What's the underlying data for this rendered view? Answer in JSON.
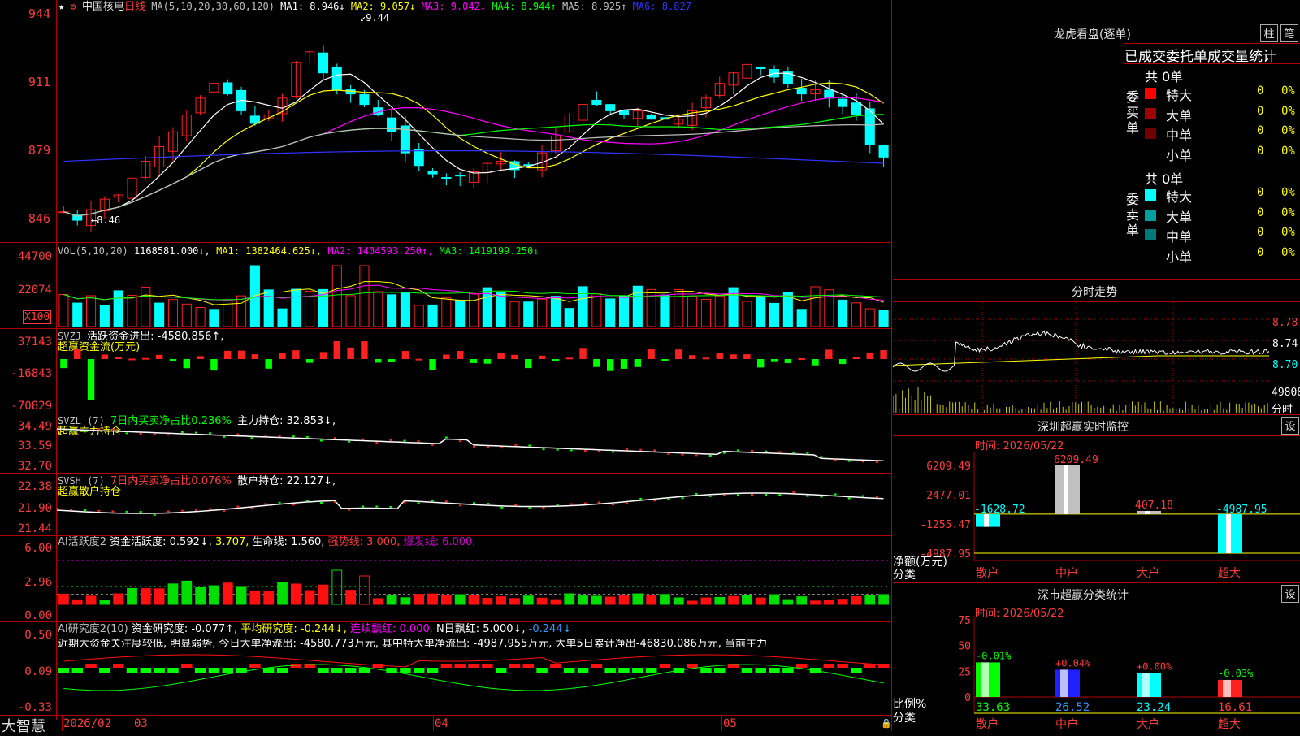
{
  "title": {
    "stock_name": "中国核电",
    "period": "日线",
    "ma_label": "MA(5,10,20,30,60,120)",
    "ma_values": [
      {
        "label": "MA1:",
        "value": "8.946↓",
        "color": "#ffffff"
      },
      {
        "label": "MA2:",
        "value": "9.057↓",
        "color": "#ffff00"
      },
      {
        "label": "MA3:",
        "value": "9.042↓",
        "color": "#ff00ff"
      },
      {
        "label": "MA4:",
        "value": "8.944↑",
        "color": "#00ff00"
      },
      {
        "label": "MA5:",
        "value": "8.925↑",
        "color": "#c0c0c0"
      },
      {
        "label": "MA6:",
        "value": "8.827",
        "color": "#3333ff"
      }
    ],
    "high_marker": "9.44",
    "low_marker": "8.46"
  },
  "price_axis": [
    "944",
    "911",
    "879",
    "846"
  ],
  "vol": {
    "label": "VOL(5,10,20)",
    "value": "1168581.000↓,",
    "ma1": "MA1: 1382464.625↓,",
    "ma2": "MA2: 1404593.250↑,",
    "ma3": "MA3: 1419199.250↓",
    "axis": [
      "44700",
      "22074",
      "X100"
    ]
  },
  "svzj": {
    "label": "SVZJ",
    "text": "活跃资金进出: -4580.856↑,",
    "sub": "超赢资金流(万元)",
    "axis": [
      "37143",
      "-16843",
      "-70829"
    ]
  },
  "svzl": {
    "label": "SVZL (7)",
    "text1": "7日内买卖净占比0.236%",
    "text2": "主力持仓: 32.853↓,",
    "sub": "超赢主力持仓",
    "axis": [
      "34.49",
      "33.59",
      "32.70"
    ]
  },
  "svsh": {
    "label": "SVSH (7)",
    "text1": "7日内买卖净占比0.076%",
    "text2": "散户持仓: 22.127↓,",
    "sub": "超赢散户持仓",
    "axis": [
      "22.38",
      "21.90",
      "21.44"
    ]
  },
  "ai_active": {
    "label": "AI活跃度2",
    "text1": "资金活跃度: 0.592↓,",
    "text2": "3.707,",
    "text3": "生命线: 1.560,",
    "text4": "强势线: 3.000,",
    "text5": "爆发线: 6.000,",
    "axis": [
      "6.00",
      "2.96",
      "0.00"
    ]
  },
  "ai_research": {
    "label": "AI研究度2(10)",
    "text1": "资金研究度: -0.077↑,",
    "text2": "平均研究度: -0.244↓,",
    "text3": "连续飘红: 0.000,",
    "text4": "N日飘红: 5.000↓,",
    "text5": "-0.244↓",
    "commentary": "近期大资金关注度较低, 明显弱势, 今日大单净流出: -4580.773万元, 其中特大单净流出: -4987.955万元, 大单5日累计净出-46830.086万元, 当前主力",
    "axis": [
      "0.50",
      "0.09",
      "-0.33"
    ]
  },
  "date_axis": {
    "brand": "大智慧",
    "labels": [
      "2026/02",
      "03",
      "04",
      "05"
    ]
  },
  "lhb": {
    "title": "龙虎看盘(逐单)",
    "btn1": "柱",
    "btn2": "笔",
    "tabs": "已成交委托单成交量统计",
    "buy_side": "委买单",
    "sell_side": "委卖单",
    "buy_total": "共 0单",
    "sell_total": "共 0单",
    "buy_rows": [
      {
        "name": "特大",
        "count": "0",
        "pct": "0%",
        "color": "#ff0000"
      },
      {
        "name": "大单",
        "count": "0",
        "pct": "0%",
        "color": "#a00000"
      },
      {
        "name": "中单",
        "count": "0",
        "pct": "0%",
        "color": "#700000"
      },
      {
        "name": "小单",
        "count": "0",
        "pct": "0%",
        "color": ""
      }
    ],
    "sell_rows": [
      {
        "name": "特大",
        "count": "0",
        "pct": "0%",
        "color": "#00ffff"
      },
      {
        "name": "大单",
        "count": "0",
        "pct": "0%",
        "color": "#00a0a0"
      },
      {
        "name": "中单",
        "count": "0",
        "pct": "0%",
        "color": "#007878"
      },
      {
        "name": "小单",
        "count": "0",
        "pct": "0%",
        "color": ""
      }
    ]
  },
  "intraday": {
    "title": "分时走势",
    "axis": [
      "8.78",
      "8.74",
      "8.70"
    ],
    "vol": "49808",
    "vol_label": "分时"
  },
  "sz_monitor": {
    "title": "深圳超赢实时监控",
    "set": "设",
    "time": "时间: 2026/05/22",
    "axis": [
      "6209.49",
      "2477.01",
      "-1255.47",
      "-4987.95"
    ],
    "unit_label": "净额(万元)",
    "cat_label": "分类",
    "bars": [
      {
        "name": "散户",
        "value": -1628.72,
        "label": "-1628.72",
        "color": "#00ffff"
      },
      {
        "name": "中户",
        "value": 6209.49,
        "label": "6209.49",
        "color": "#ff2020"
      },
      {
        "name": "大户",
        "value": 407.18,
        "label": "407.18",
        "color": "#ff2020"
      },
      {
        "name": "超大",
        "value": -4987.95,
        "label": "-4987.95",
        "color": "#00ffff"
      }
    ]
  },
  "sz_stats": {
    "title": "深市超赢分类统计",
    "set": "设",
    "time": "时间: 2026/05/22",
    "axis": [
      "75",
      "50",
      "25",
      "0"
    ],
    "ratio_label": "比例%",
    "cat_label": "分类",
    "bars": [
      {
        "name": "散户",
        "value": 33.63,
        "change": "-0.01%",
        "color": "#00ff00",
        "pct_color": "#00ff00"
      },
      {
        "name": "中户",
        "value": 26.52,
        "change": "+0.04%",
        "color": "#2020ff",
        "pct_color": "#ff3b3b"
      },
      {
        "name": "大户",
        "value": 23.24,
        "change": "+0.00%",
        "color": "#00ffff",
        "pct_color": "#ff3b3b"
      },
      {
        "name": "超大",
        "value": 16.61,
        "change": "-0.03%",
        "color": "#ff2020",
        "pct_color": "#00ff00"
      }
    ]
  },
  "colors": {
    "up": "#ff2020",
    "down": "#00ffff",
    "grid": "#b00000"
  }
}
